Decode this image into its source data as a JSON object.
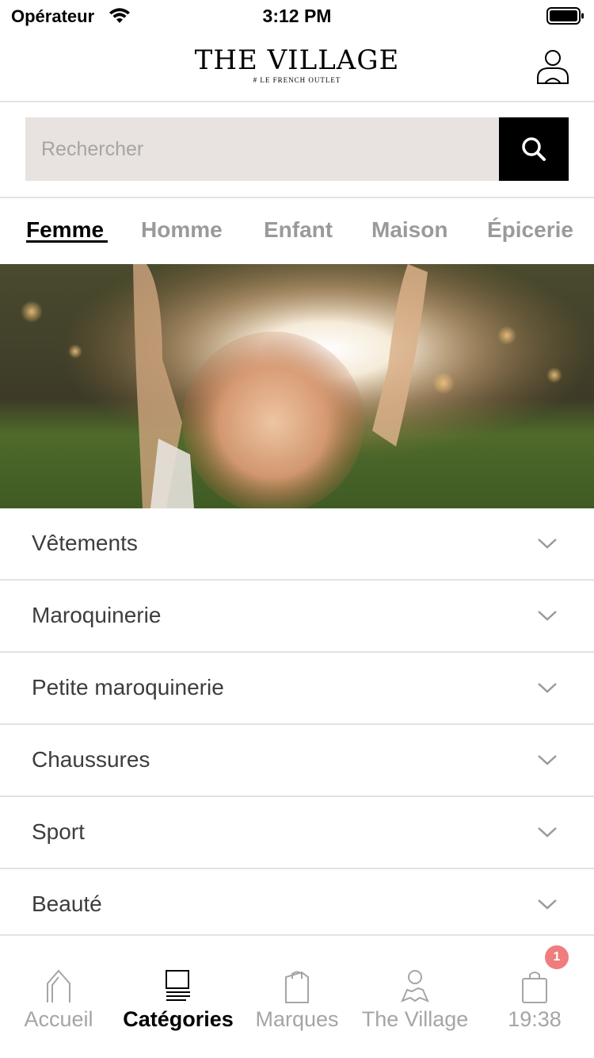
{
  "status_bar": {
    "carrier": "Opérateur",
    "time": "3:12 PM"
  },
  "header": {
    "logo_main": "THE VILLAGE",
    "logo_sub": "# LE FRENCH OUTLET"
  },
  "search": {
    "placeholder": "Rechercher"
  },
  "tabs": [
    {
      "label": "Femme",
      "active": true
    },
    {
      "label": "Homme",
      "active": false
    },
    {
      "label": "Enfant",
      "active": false
    },
    {
      "label": "Maison",
      "active": false
    },
    {
      "label": "Épicerie",
      "active": false
    }
  ],
  "categories": [
    {
      "label": "Vêtements"
    },
    {
      "label": "Maroquinerie"
    },
    {
      "label": "Petite maroquinerie"
    },
    {
      "label": "Chaussures"
    },
    {
      "label": "Sport"
    },
    {
      "label": "Beauté"
    }
  ],
  "bottom_nav": [
    {
      "label": "Accueil",
      "icon": "home-icon",
      "active": false
    },
    {
      "label": "Catégories",
      "icon": "categories-icon",
      "active": true
    },
    {
      "label": "Marques",
      "icon": "shopping-bag-icon",
      "active": false
    },
    {
      "label": "The Village",
      "icon": "village-map-icon",
      "active": false
    },
    {
      "label": "19:38",
      "icon": "cart-icon",
      "active": false,
      "badge": "1"
    }
  ],
  "colors": {
    "accent": "#000000",
    "search_bg": "#e8e3e0",
    "inactive_text": "#9a9a9a",
    "badge": "#ef7d7d"
  }
}
